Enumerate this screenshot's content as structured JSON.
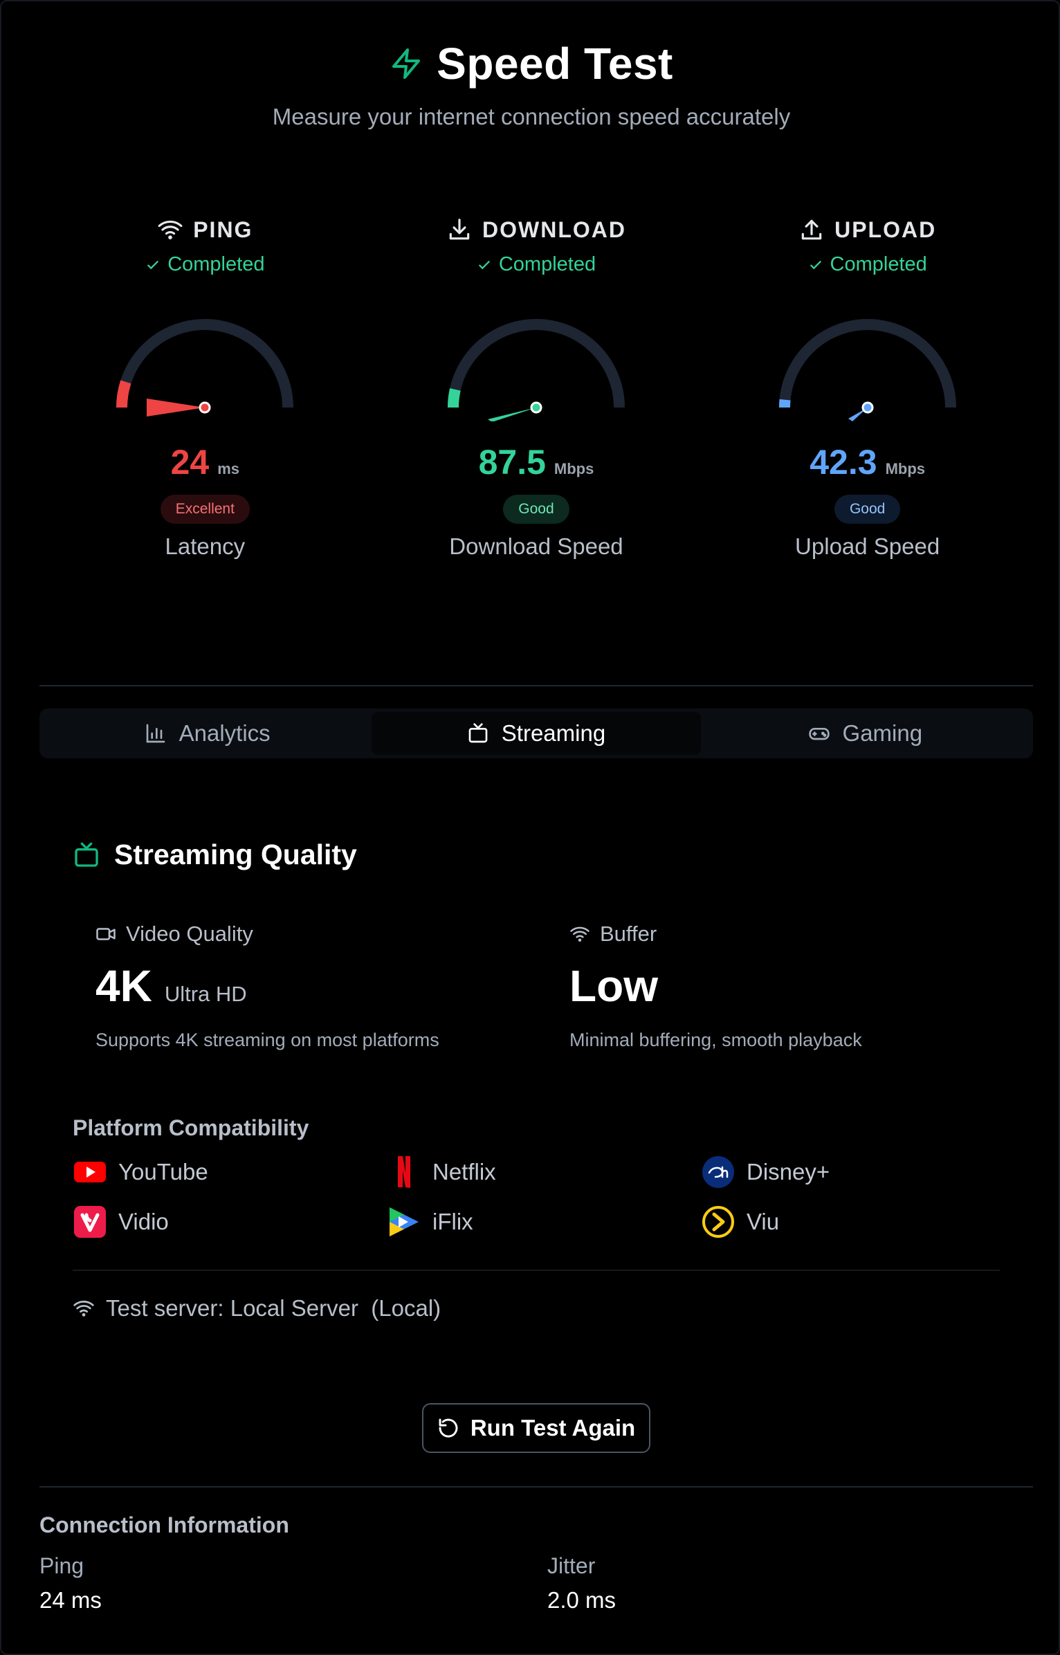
{
  "header": {
    "title": "Speed Test",
    "subtitle": "Measure your internet connection speed accurately"
  },
  "meters": [
    {
      "label": "PING",
      "status": "Completed",
      "value": "24",
      "unit": "ms",
      "badge": "Excellent",
      "caption": "Latency",
      "fill": 0.1
    },
    {
      "label": "DOWNLOAD",
      "status": "Completed",
      "value": "87.5",
      "unit": "Mbps",
      "badge": "Good",
      "caption": "Download Speed",
      "fill": 0.07
    },
    {
      "label": "UPLOAD",
      "status": "Completed",
      "value": "42.3",
      "unit": "Mbps",
      "badge": "Good",
      "caption": "Upload Speed",
      "fill": 0.03
    }
  ],
  "colors": {
    "ping": "#ef4444",
    "download": "#34d399",
    "upload": "#60a5fa",
    "accent": "#10b981",
    "track": "#1e2533"
  },
  "icons": {
    "title": "lightning-icon",
    "ping": "wifi-icon",
    "download": "download-icon",
    "upload": "upload-icon"
  },
  "tabs": [
    {
      "label": "Analytics",
      "icon": "bar-chart-icon",
      "active": false
    },
    {
      "label": "Streaming",
      "icon": "tv-icon",
      "active": true
    },
    {
      "label": "Gaming",
      "icon": "gamepad-icon",
      "active": false
    }
  ],
  "streaming": {
    "title": "Streaming Quality",
    "video": {
      "label": "Video Quality",
      "value": "4K",
      "sub": "Ultra HD",
      "desc": "Supports 4K streaming on most platforms"
    },
    "buffer": {
      "label": "Buffer",
      "value": "Low",
      "desc": "Minimal buffering, smooth playback"
    },
    "platform_title": "Platform Compatibility",
    "platforms": [
      "YouTube",
      "Netflix",
      "Disney+",
      "Vidio",
      "iFlix",
      "Viu"
    ],
    "server": "Test server: Local Server  (Local)"
  },
  "run_button": "Run Test Again",
  "connection": {
    "title": "Connection Information",
    "items": [
      {
        "label": "Ping",
        "value": "24 ms"
      },
      {
        "label": "Jitter",
        "value": "2.0 ms"
      }
    ]
  }
}
